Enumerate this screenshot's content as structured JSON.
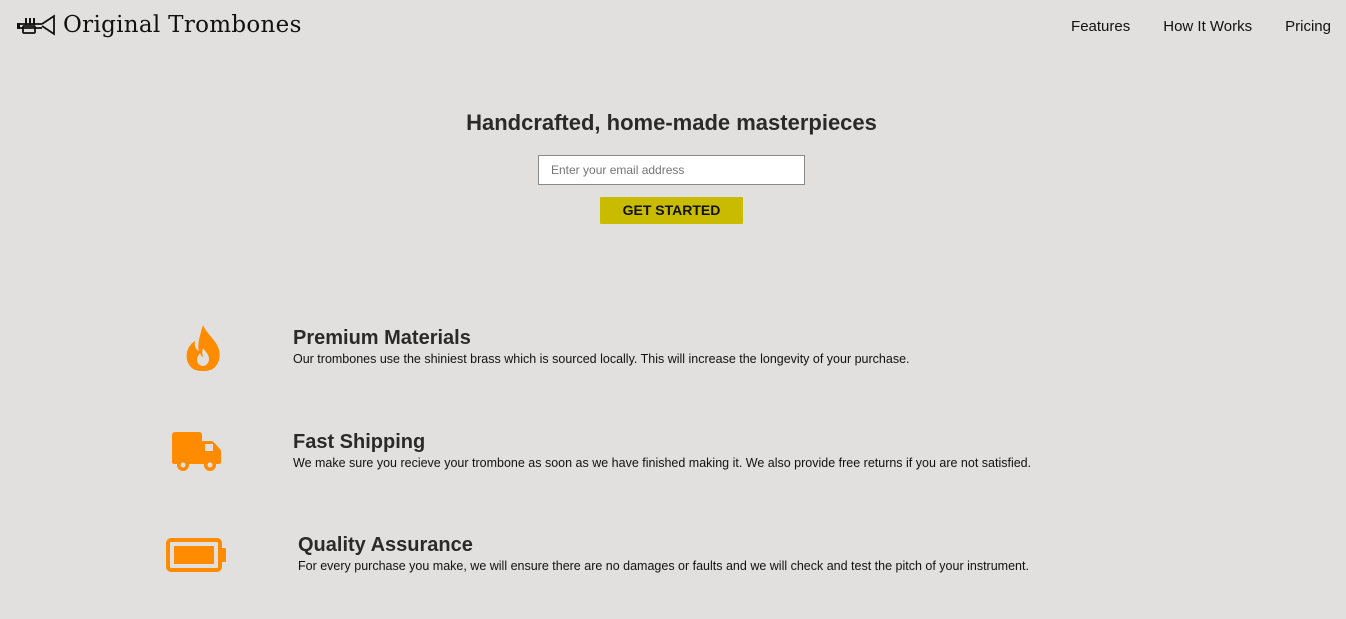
{
  "header": {
    "brand": "Original Trombones",
    "nav": [
      {
        "label": "Features"
      },
      {
        "label": "How It Works"
      },
      {
        "label": "Pricing"
      }
    ]
  },
  "hero": {
    "title": "Handcrafted, home-made masterpieces",
    "email_placeholder": "Enter your email address",
    "cta_label": "GET STARTED"
  },
  "features": [
    {
      "icon": "fire-icon",
      "title": "Premium Materials",
      "description": "Our trombones use the shiniest brass which is sourced locally. This will increase the longevity of your purchase."
    },
    {
      "icon": "truck-icon",
      "title": "Fast Shipping",
      "description": "We make sure you recieve your trombone as soon as we have finished making it. We also provide free returns if you are not satisfied."
    },
    {
      "icon": "battery-icon",
      "title": "Quality Assurance",
      "description": "For every purchase you make, we will ensure there are no damages or faults and we will check and test the pitch of your instrument."
    }
  ],
  "colors": {
    "background": "#e2e0df",
    "accent_icon": "#ff8c00",
    "cta": "#c9bb00",
    "text": "#2a2a2a"
  }
}
